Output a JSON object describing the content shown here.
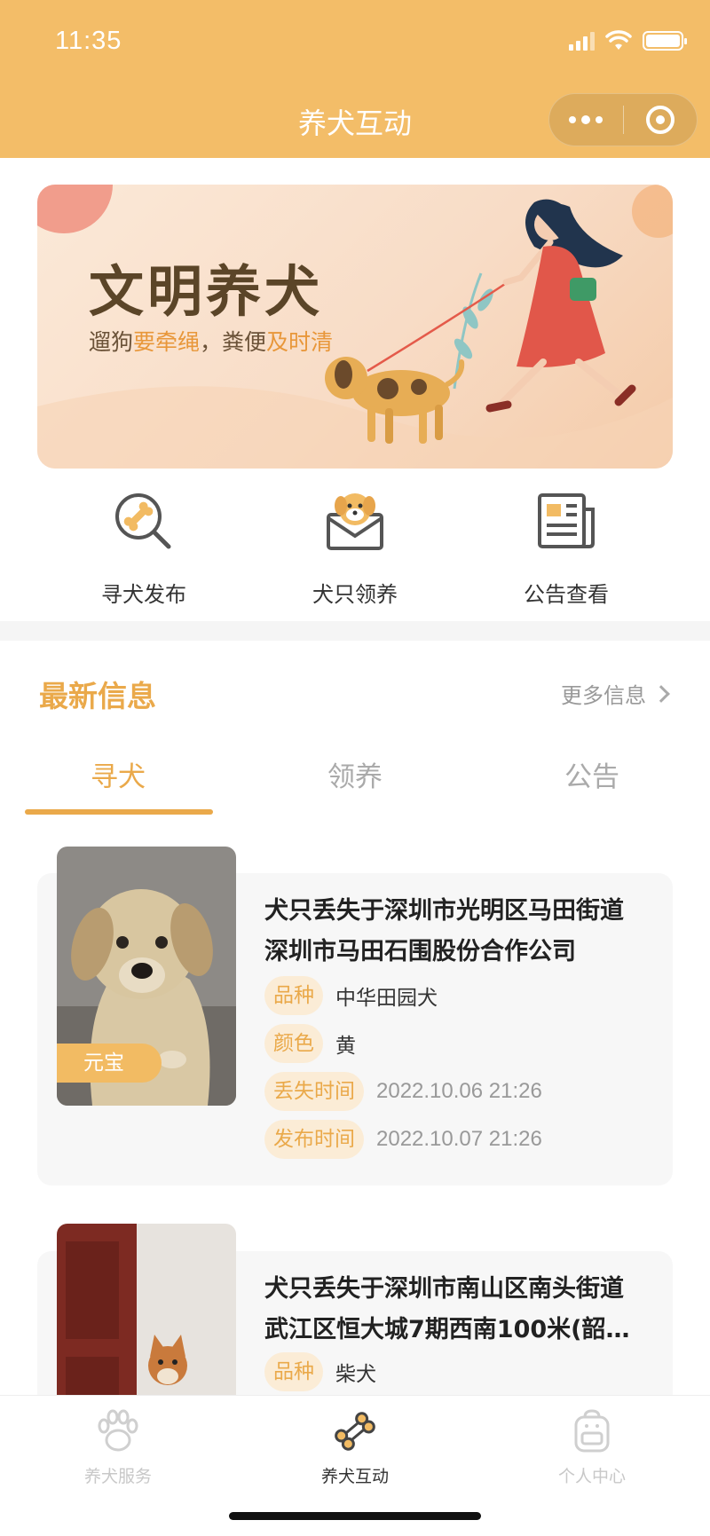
{
  "status_bar": {
    "time": "11:35"
  },
  "nav": {
    "title": "养犬互动"
  },
  "banner": {
    "title": "文明养犬",
    "subtitle_parts": [
      "遛狗",
      "要牵绳",
      "，粪便",
      "及时清"
    ]
  },
  "quick_actions": [
    {
      "label": "寻犬发布",
      "icon": "bone-search-icon"
    },
    {
      "label": "犬只领养",
      "icon": "dog-envelope-icon"
    },
    {
      "label": "公告查看",
      "icon": "newspaper-icon"
    }
  ],
  "latest": {
    "title": "最新信息",
    "more_label": "更多信息",
    "tabs": [
      {
        "label": "寻犬",
        "active": true
      },
      {
        "label": "领养",
        "active": false
      },
      {
        "label": "公告",
        "active": false
      }
    ]
  },
  "cards": [
    {
      "pet_name": "元宝",
      "title_line1": "犬只丢失于深圳市光明区马田街道",
      "title_line2": "深圳市马田石围股份合作公司",
      "breed_label": "品种",
      "breed": "中华田园犬",
      "color_label": "颜色",
      "color": "黄",
      "lost_time_label": "丢失时间",
      "lost_time": "2022.10.06 21:26",
      "post_time_label": "发布时间",
      "post_time": "2022.10.07 21:26"
    },
    {
      "title_line1": "犬只丢失于深圳市南山区南头街道",
      "title_line2": "武江区恒大城7期西南100米(韶…",
      "breed_label": "品种",
      "breed": "柴犬"
    }
  ],
  "tabbar": [
    {
      "label": "养犬服务",
      "icon": "paw-icon",
      "active": false
    },
    {
      "label": "养犬互动",
      "icon": "bone-icon",
      "active": true
    },
    {
      "label": "个人中心",
      "icon": "backpack-icon",
      "active": false
    }
  ],
  "colors": {
    "header": "#f3bd68",
    "accent": "#eaa94a",
    "tag_bg": "#fbecd6"
  }
}
